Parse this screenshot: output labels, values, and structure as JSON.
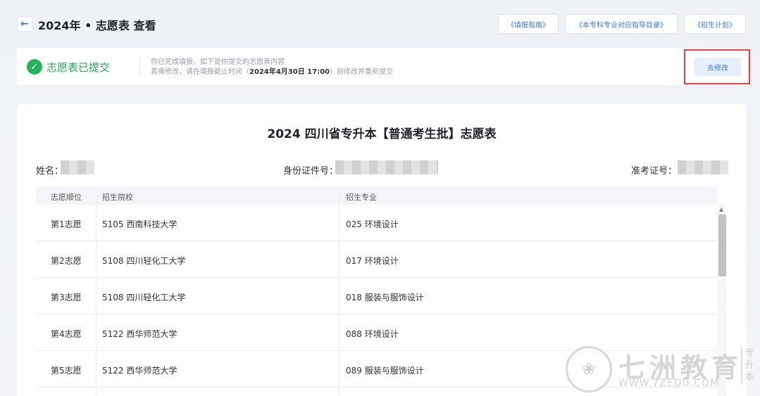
{
  "header": {
    "back_icon": "arrow-left-icon",
    "title": "2024年 • 志愿表 查看",
    "links": [
      "《填报指南》",
      "《本专科专业对应指导目录》",
      "《招生计划》"
    ]
  },
  "status": {
    "icon": "check-circle-icon",
    "text": "志愿表已提交",
    "line1": "你已完成填报，如下是你提交的志愿表内容",
    "line2_pre": "若需修改，请在填报截止时间（",
    "deadline": "2024年4月30日 17:00",
    "line2_post": "）前修改并重新提交",
    "modify_label": "去修改"
  },
  "form": {
    "title": "2024 四川省专升本【普通考生批】志愿表",
    "name_label": "姓名：",
    "id_label": "身份证件号：",
    "ticket_label": "准考证号："
  },
  "table": {
    "headers": [
      "志愿顺位",
      "招生院校",
      "招生专业"
    ],
    "rows": [
      {
        "rank": "第1志愿",
        "school": "5105 西南科技大学",
        "major": "025 环境设计"
      },
      {
        "rank": "第2志愿",
        "school": "5108 四川轻化工大学",
        "major": "017 环境设计"
      },
      {
        "rank": "第3志愿",
        "school": "5108 四川轻化工大学",
        "major": "018 服装与服饰设计"
      },
      {
        "rank": "第4志愿",
        "school": "5122 西华师范大学",
        "major": "088 环境设计"
      },
      {
        "rank": "第5志愿",
        "school": "5122 西华师范大学",
        "major": "089 服装与服饰设计"
      }
    ]
  },
  "watermark": {
    "name": "七洲教育",
    "url": "WWW.7ZEDU.COM",
    "side": "专升本"
  },
  "colors": {
    "accent": "#3a78e6",
    "success": "#27a85a",
    "highlight_box": "#e64040"
  }
}
